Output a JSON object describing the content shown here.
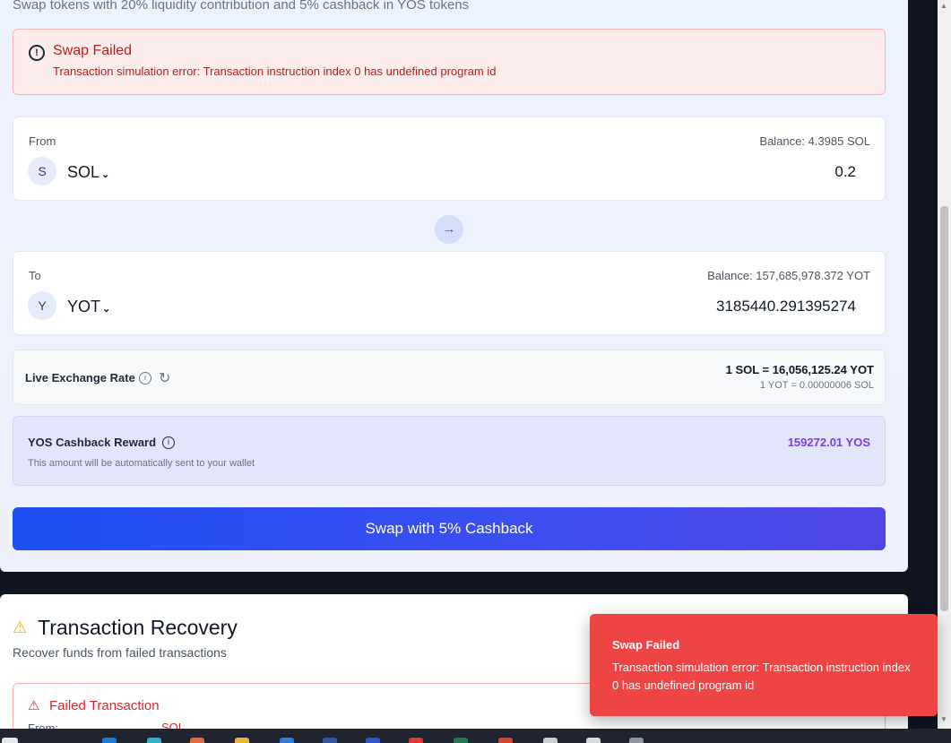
{
  "header": {
    "subtitle": "Swap tokens with 20% liquidity contribution and 5% cashback in YOS tokens"
  },
  "error_banner": {
    "title": "Swap Failed",
    "message": "Transaction simulation error: Transaction instruction index 0 has undefined program id",
    "icon": "alert-circle-icon"
  },
  "from": {
    "label": "From",
    "balance": "Balance: 4.3985 SOL",
    "token_initial": "S",
    "token": "SOL",
    "amount": "0.2"
  },
  "swap_direction_icon": "arrow-right-icon",
  "to": {
    "label": "To",
    "balance": "Balance: 157,685,978.372 YOT",
    "token_initial": "Y",
    "token": "YOT",
    "amount": "3185440.291395274"
  },
  "rate": {
    "label": "Live Exchange Rate",
    "main": "1 SOL = 16,056,125.24 YOT",
    "inverse": "1 YOT = 0.00000006 SOL"
  },
  "cashback": {
    "title": "YOS Cashback Reward",
    "note": "This amount will be automatically sent to your wallet",
    "value": "159272.01 YOS",
    "value_color": "#7c3aed"
  },
  "swap_button": {
    "label": "Swap with 5% Cashback"
  },
  "recovery": {
    "title": "Transaction Recovery",
    "subtitle": "Recover funds from failed transactions",
    "failed_title": "Failed Transaction",
    "from_label": "From:",
    "from_token": "SOL"
  },
  "toast": {
    "title": "Swap Failed",
    "message": "Transaction simulation error: Transaction instruction index 0 has undefined program id",
    "color": "#ef4444"
  }
}
